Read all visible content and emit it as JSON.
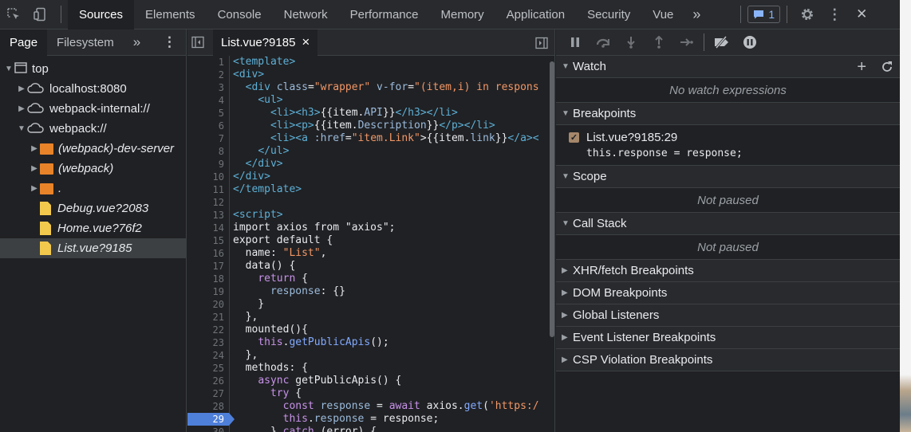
{
  "topbar": {
    "tabs": [
      {
        "label": "Sources",
        "active": true
      },
      {
        "label": "Elements"
      },
      {
        "label": "Console"
      },
      {
        "label": "Network"
      },
      {
        "label": "Performance"
      },
      {
        "label": "Memory"
      },
      {
        "label": "Application"
      },
      {
        "label": "Security"
      },
      {
        "label": "Vue"
      }
    ],
    "more_tabs": "»",
    "issues_count": "1",
    "close": "✕"
  },
  "navigator": {
    "tabs": [
      {
        "label": "Page",
        "active": true
      },
      {
        "label": "Filesystem"
      }
    ],
    "more": "»",
    "tree": [
      {
        "label": "top",
        "type": "frame",
        "depth": 0,
        "expanded": true
      },
      {
        "label": "localhost:8080",
        "type": "cloud",
        "depth": 1,
        "expanded": false
      },
      {
        "label": "webpack-internal://",
        "type": "cloud",
        "depth": 1,
        "expanded": false
      },
      {
        "label": "webpack://",
        "type": "cloud",
        "depth": 1,
        "expanded": true
      },
      {
        "label": "(webpack)-dev-server",
        "type": "folder",
        "depth": 2,
        "expanded": false
      },
      {
        "label": "(webpack)",
        "type": "folder",
        "depth": 2,
        "expanded": false
      },
      {
        "label": ".",
        "type": "folder",
        "depth": 2,
        "expanded": false
      },
      {
        "label": "Debug.vue?2083",
        "type": "file",
        "depth": 2
      },
      {
        "label": "Home.vue?76f2",
        "type": "file",
        "depth": 2
      },
      {
        "label": "List.vue?9185",
        "type": "file",
        "depth": 2,
        "selected": true
      }
    ]
  },
  "editor": {
    "tab_label": "List.vue?9185",
    "tab_close": "×",
    "breakpoint_line": 29,
    "lines": [
      [
        [
          "<template>",
          "tg"
        ]
      ],
      [
        [
          "<div>",
          "tg"
        ]
      ],
      [
        [
          "  ",
          ""
        ],
        [
          "<div ",
          "tg"
        ],
        [
          "class",
          "at"
        ],
        [
          "=",
          ""
        ],
        [
          "\"wrapper\"",
          "sv"
        ],
        [
          " v-for",
          "at"
        ],
        [
          "=",
          ""
        ],
        [
          "\"(item,i) in respons",
          "sv"
        ]
      ],
      [
        [
          "    ",
          ""
        ],
        [
          "<ul>",
          "tg"
        ]
      ],
      [
        [
          "      ",
          ""
        ],
        [
          "<li><h3>",
          "tg"
        ],
        [
          "{{item.",
          ""
        ],
        [
          "API",
          "pr"
        ],
        [
          "}}",
          ""
        ],
        [
          "</h3></li>",
          "tg"
        ]
      ],
      [
        [
          "      ",
          ""
        ],
        [
          "<li><p>",
          "tg"
        ],
        [
          "{{item.",
          ""
        ],
        [
          "Description",
          "pr"
        ],
        [
          "}}",
          ""
        ],
        [
          "</p></li>",
          "tg"
        ]
      ],
      [
        [
          "      ",
          ""
        ],
        [
          "<li><a ",
          "tg"
        ],
        [
          ":href",
          "at"
        ],
        [
          "=",
          ""
        ],
        [
          "\"item.Link\"",
          "sv"
        ],
        [
          ">",
          ""
        ],
        [
          "{{item.",
          ""
        ],
        [
          "link",
          "pr"
        ],
        [
          "}}",
          ""
        ],
        [
          "</a><",
          "tg"
        ]
      ],
      [
        [
          "    ",
          ""
        ],
        [
          "</ul>",
          "tg"
        ]
      ],
      [
        [
          "  ",
          ""
        ],
        [
          "</div>",
          "tg"
        ]
      ],
      [
        [
          "</div>",
          "tg"
        ]
      ],
      [
        [
          "</template>",
          "tg"
        ]
      ],
      [
        [
          "",
          ""
        ]
      ],
      [
        [
          "<script>",
          "tg"
        ]
      ],
      [
        [
          "import axios from \"axios\";",
          ""
        ]
      ],
      [
        [
          "export default {",
          ""
        ]
      ],
      [
        [
          "  name: ",
          ""
        ],
        [
          "\"List\"",
          "st"
        ],
        [
          ",",
          ""
        ]
      ],
      [
        [
          "  data() {",
          ""
        ]
      ],
      [
        [
          "    ",
          ""
        ],
        [
          "return",
          "kw"
        ],
        [
          " {",
          ""
        ]
      ],
      [
        [
          "      ",
          ""
        ],
        [
          "response",
          "pr"
        ],
        [
          ": {}",
          ""
        ]
      ],
      [
        [
          "    }",
          ""
        ]
      ],
      [
        [
          "  },",
          ""
        ]
      ],
      [
        [
          "  mounted(){",
          ""
        ]
      ],
      [
        [
          "    ",
          ""
        ],
        [
          "this",
          "kw"
        ],
        [
          ".",
          ""
        ],
        [
          "getPublicApis",
          "fn"
        ],
        [
          "();",
          ""
        ]
      ],
      [
        [
          "  },",
          ""
        ]
      ],
      [
        [
          "  methods: {",
          ""
        ]
      ],
      [
        [
          "    ",
          ""
        ],
        [
          "async",
          "kw"
        ],
        [
          " getPublicApis() {",
          ""
        ]
      ],
      [
        [
          "      ",
          ""
        ],
        [
          "try",
          "kw"
        ],
        [
          " {",
          ""
        ]
      ],
      [
        [
          "        ",
          ""
        ],
        [
          "const",
          "kw"
        ],
        [
          " ",
          ""
        ],
        [
          "response",
          "pr"
        ],
        [
          " = ",
          ""
        ],
        [
          "await",
          "kw"
        ],
        [
          " axios.",
          ""
        ],
        [
          "get",
          "fn"
        ],
        [
          "(",
          ""
        ],
        [
          "'https:/",
          "st"
        ]
      ],
      [
        [
          "        ",
          ""
        ],
        [
          "this",
          "kw"
        ],
        [
          ".",
          ""
        ],
        [
          "response",
          "pr"
        ],
        [
          " = response;",
          ""
        ]
      ],
      [
        [
          "      } ",
          ""
        ],
        [
          "catch",
          "kw"
        ],
        [
          " (error) {",
          ""
        ]
      ]
    ]
  },
  "debugger": {
    "sections": {
      "watch": "Watch",
      "watch_empty": "No watch expressions",
      "breakpoints": "Breakpoints",
      "breakpoint_file": "List.vue?9185:29",
      "breakpoint_code": "this.response = response;",
      "scope": "Scope",
      "scope_empty": "Not paused",
      "callstack": "Call Stack",
      "callstack_empty": "Not paused",
      "xhr": "XHR/fetch Breakpoints",
      "dom": "DOM Breakpoints",
      "global": "Global Listeners",
      "event": "Event Listener Breakpoints",
      "csp": "CSP Violation Breakpoints"
    },
    "watch_add": "+"
  }
}
